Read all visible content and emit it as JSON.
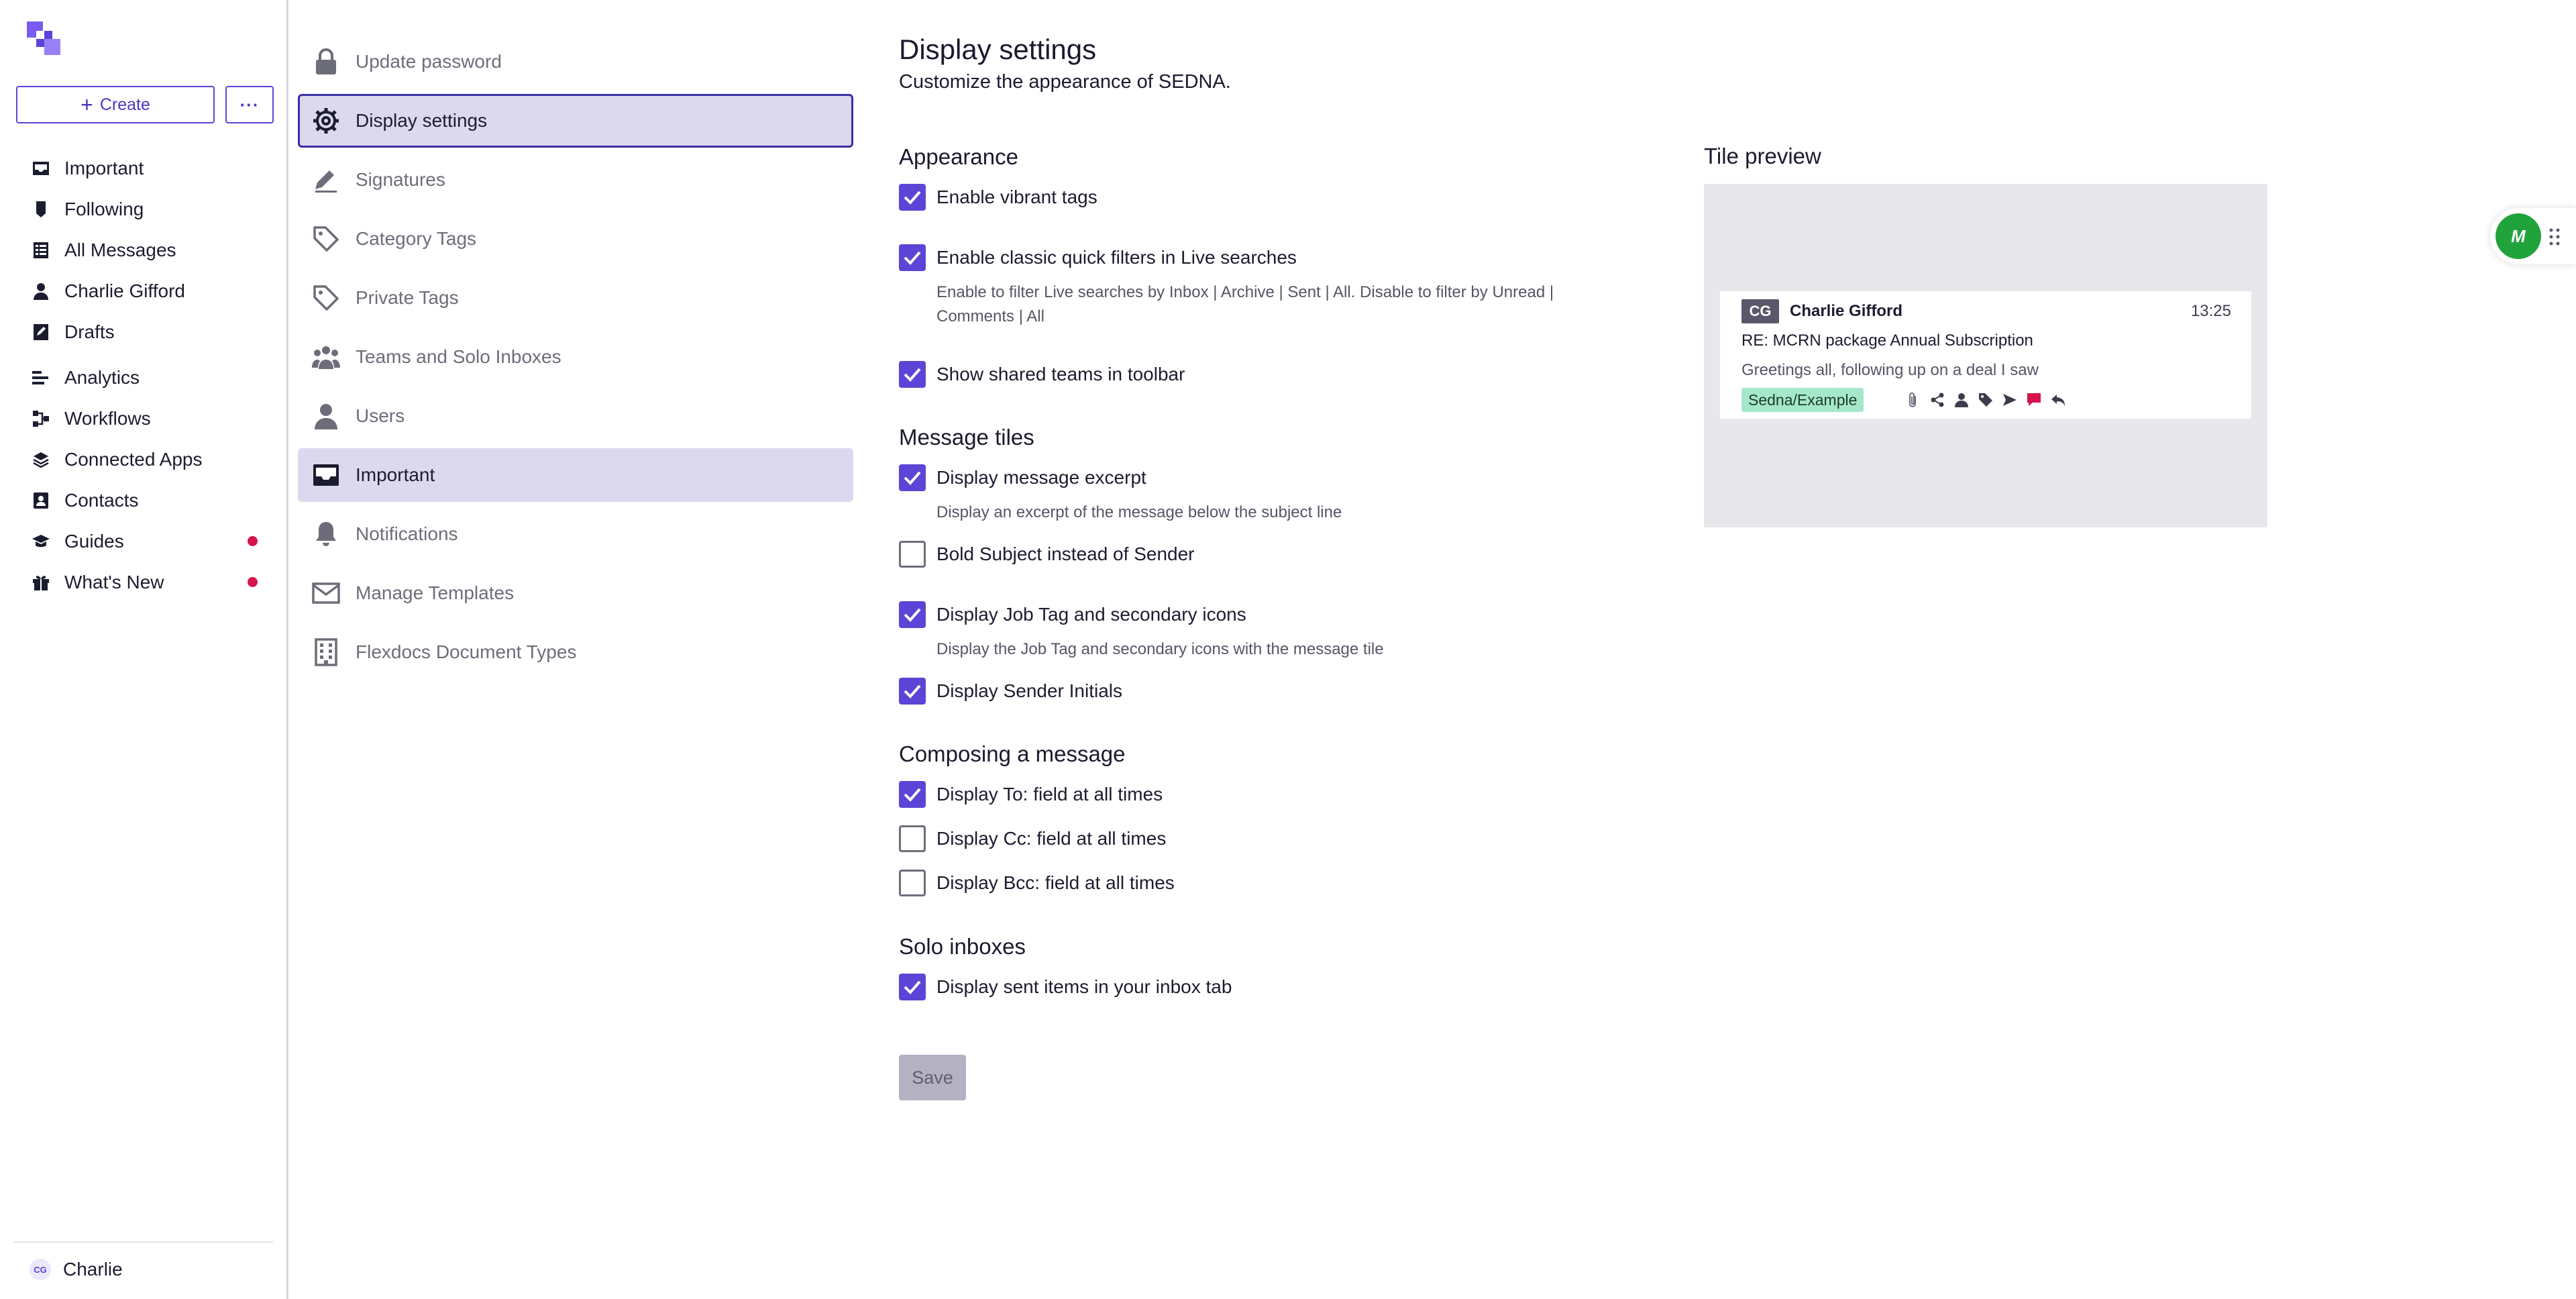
{
  "app": {
    "brand_color": "#5b45d6"
  },
  "sidebar": {
    "create_label": "Create",
    "more_label": "···",
    "items": [
      {
        "label": "Important",
        "icon": "inbox-icon"
      },
      {
        "label": "Following",
        "icon": "bookmark-icon"
      },
      {
        "label": "All Messages",
        "icon": "list-icon"
      },
      {
        "label": "Charlie Gifford",
        "icon": "person-icon"
      },
      {
        "label": "Drafts",
        "icon": "drafts-icon"
      },
      {
        "label": "Analytics",
        "icon": "analytics-icon"
      },
      {
        "label": "Workflows",
        "icon": "workflows-icon"
      },
      {
        "label": "Connected Apps",
        "icon": "layers-icon"
      },
      {
        "label": "Contacts",
        "icon": "contacts-icon"
      },
      {
        "label": "Guides",
        "icon": "graduation-cap-icon",
        "dot": true
      },
      {
        "label": "What's New",
        "icon": "gift-icon",
        "dot": true
      }
    ],
    "user": {
      "initials": "CG",
      "name": "Charlie"
    }
  },
  "settings_menu": {
    "items": [
      {
        "label": "Update password",
        "icon": "lock-icon"
      },
      {
        "label": "Display settings",
        "icon": "gear-icon",
        "state": "active"
      },
      {
        "label": "Signatures",
        "icon": "pen-icon"
      },
      {
        "label": "Category Tags",
        "icon": "tag-icon"
      },
      {
        "label": "Private Tags",
        "icon": "tag-icon"
      },
      {
        "label": "Teams and Solo Inboxes",
        "icon": "team-icon"
      },
      {
        "label": "Users",
        "icon": "user-icon"
      },
      {
        "label": "Important",
        "icon": "inbox-icon",
        "state": "selected"
      },
      {
        "label": "Notifications",
        "icon": "bell-icon"
      },
      {
        "label": "Manage Templates",
        "icon": "mail-icon"
      },
      {
        "label": "Flexdocs Document Types",
        "icon": "building-icon"
      }
    ]
  },
  "main": {
    "title": "Display settings",
    "subtitle": "Customize the appearance of SEDNA.",
    "sections": {
      "appearance": "Appearance",
      "message_tiles": "Message tiles",
      "composing": "Composing a message",
      "solo": "Solo inboxes"
    },
    "options": {
      "vibrant_tags": {
        "label": "Enable vibrant tags",
        "checked": true
      },
      "classic_filters": {
        "label": "Enable classic quick filters in Live searches",
        "checked": true,
        "hint": "Enable to filter Live searches by Inbox | Archive | Sent | All. Disable to filter by Unread | Comments | All"
      },
      "shared_teams": {
        "label": "Show shared teams in toolbar",
        "checked": true
      },
      "excerpt": {
        "label": "Display message excerpt",
        "checked": true,
        "hint": "Display an excerpt of the message below the subject line"
      },
      "bold_subject": {
        "label": "Bold Subject instead of Sender",
        "checked": false
      },
      "job_tag": {
        "label": "Display Job Tag and secondary icons",
        "checked": true,
        "hint": "Display the Job Tag and secondary icons with the message tile"
      },
      "initials": {
        "label": "Display Sender Initials",
        "checked": true
      },
      "to_field": {
        "label": "Display To: field at all times",
        "checked": true
      },
      "cc_field": {
        "label": "Display Cc: field at all times",
        "checked": false
      },
      "bcc_field": {
        "label": "Display Bcc: field at all times",
        "checked": false
      },
      "sent_items": {
        "label": "Display sent items in your inbox tab",
        "checked": true
      }
    },
    "save_label": "Save"
  },
  "preview": {
    "title": "Tile preview",
    "tile": {
      "initials": "CG",
      "sender": "Charlie Gifford",
      "time": "13:25",
      "subject": "RE: MCRN package Annual Subscription",
      "excerpt": "Greetings all, following up on a deal I saw",
      "tag": "Sedna/Example",
      "tag_color": "#a5e8c9",
      "icons": [
        "paperclip-icon",
        "share-icon",
        "user-icon",
        "tag-icon",
        "send-icon",
        "comment-icon",
        "reply-icon"
      ]
    }
  },
  "widget": {
    "label": "M"
  }
}
